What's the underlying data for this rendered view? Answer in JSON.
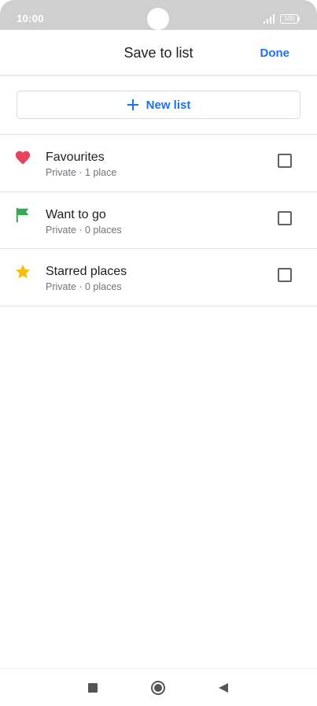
{
  "status_bar": {
    "time": "10:00",
    "battery": "100",
    "icons": [
      "signal-icon",
      "battery-icon"
    ]
  },
  "header": {
    "title": "Save to list",
    "done_label": "Done"
  },
  "new_list": {
    "label": "New list",
    "icon": "plus-icon"
  },
  "lists": [
    {
      "title": "Favourites",
      "subtitle": "Private · 1 place",
      "icon": "heart-icon",
      "checked": false
    },
    {
      "title": "Want to go",
      "subtitle": "Private · 0 places",
      "icon": "flag-icon",
      "checked": false
    },
    {
      "title": "Starred places",
      "subtitle": "Private · 0 places",
      "icon": "star-icon",
      "checked": false
    }
  ],
  "nav": {
    "icons": [
      "recents-icon",
      "home-icon",
      "back-icon"
    ]
  },
  "colors": {
    "accent": "#1a73e8",
    "heart": "#e8435e",
    "flag": "#34a853",
    "star": "#fbbc04",
    "status_bar": "#cfcfcf"
  }
}
